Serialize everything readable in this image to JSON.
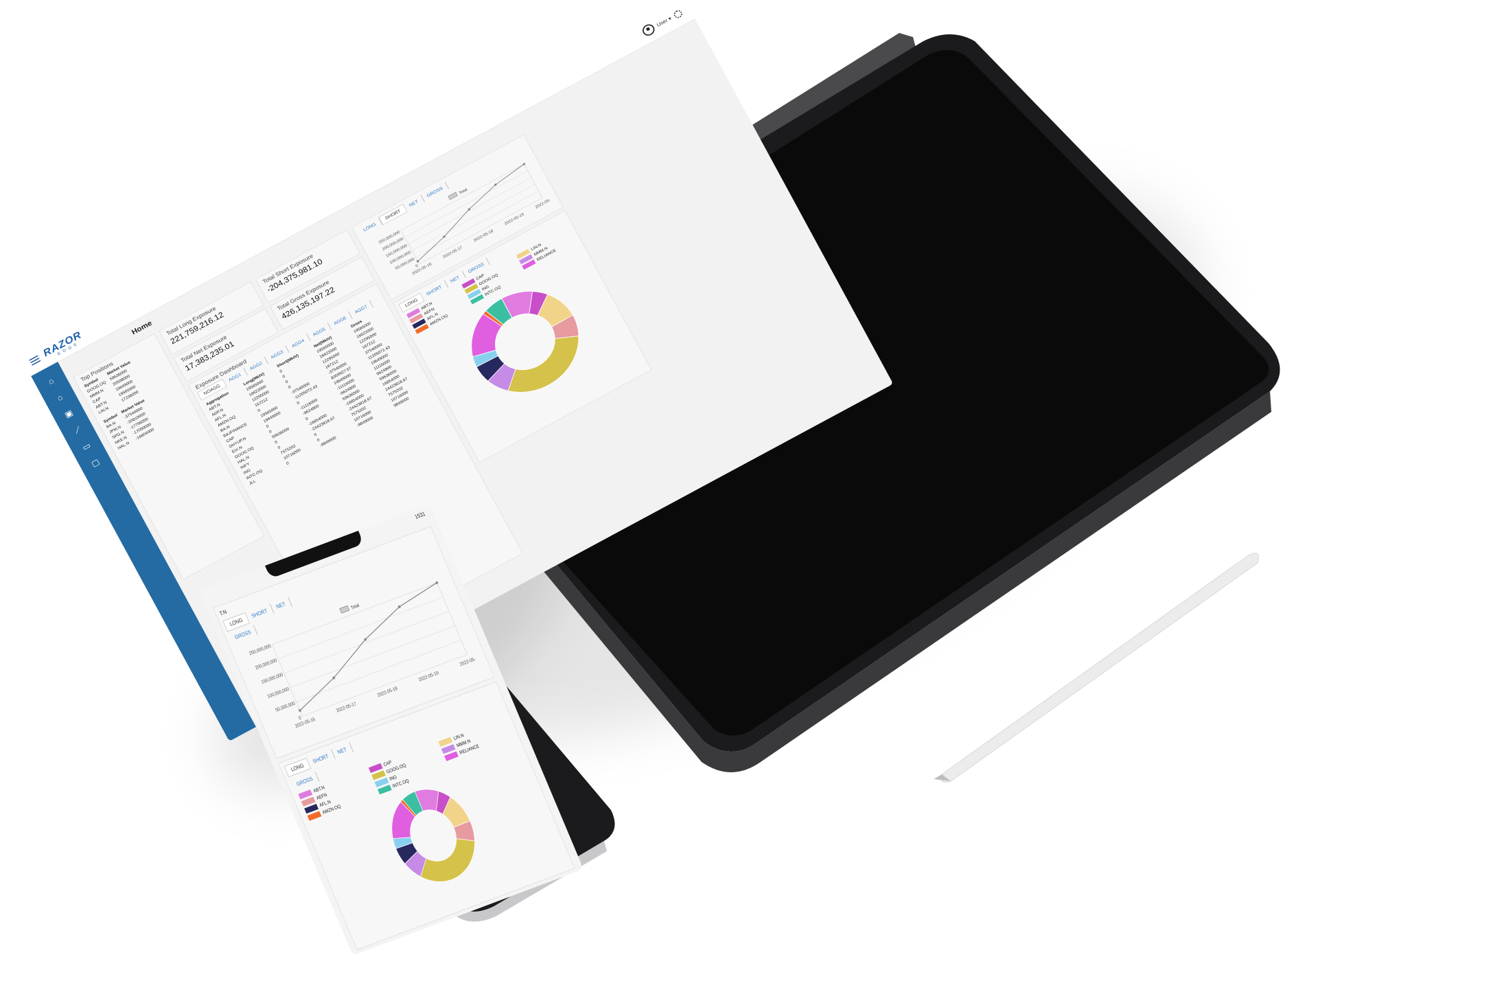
{
  "app": {
    "logo_main": "RAZOR",
    "logo_sub": "EDGE",
    "user_label": "User ▾"
  },
  "tablet": {
    "page_title": "Home",
    "top_positions": {
      "title": "Top Positions",
      "long_headers": [
        "Symbol",
        "Market Value"
      ],
      "long_rows": [
        [
          "GOOG.OQ",
          "59636000"
        ],
        [
          "MMM.N",
          "20598000"
        ],
        [
          "CAP",
          "19649000"
        ],
        [
          "ABT.N",
          "19565000"
        ],
        [
          "LIN.N",
          "17236000"
        ]
      ],
      "short_headers": [
        "Symbol",
        "Market Value"
      ],
      "short_rows": [
        [
          "BA.N",
          "-37540000"
        ],
        [
          "JPM.N",
          "-20810000"
        ],
        [
          "SPG.N",
          "-17796000"
        ],
        [
          "NKE.N",
          "-17090000"
        ],
        [
          "HAL.N",
          "-16604000"
        ]
      ]
    },
    "exposure": {
      "long_title": "Total Long Exposure",
      "long_value": "221,759,216.12",
      "short_title": "Total Short Exposure",
      "short_value": "-204,375,981.10",
      "net_title": "Total Net Exposure",
      "net_value": "17,383,235.01",
      "gross_title": "Total Gross Exposure",
      "gross_value": "426,135,197.22"
    },
    "dashboard": {
      "title": "Exposure Dashboard",
      "tabs": [
        "NOAGG",
        "AGG1",
        "AGG2",
        "AGG3",
        "AGG4",
        "AGG5",
        "AGG6",
        "AGG7"
      ],
      "headers": [
        "Aggregation",
        "Long(MktV)",
        "Short(MktV)",
        "Net(MktV)",
        "Gross"
      ],
      "rows": [
        [
          "ABT.N",
          "19565000",
          "0",
          "19565000",
          "19565000"
        ],
        [
          "ADF.N",
          "16622000",
          "0",
          "16622000",
          "16622000"
        ],
        [
          "AFL.N",
          "12295000",
          "0",
          "12295000",
          "12295000"
        ],
        [
          "AMZN.OQ",
          "167212",
          "0",
          "167212",
          "167212"
        ],
        [
          "BA.N",
          "0",
          "-37540000",
          "-37540000",
          "37540000"
        ],
        [
          "BAJFINANCE",
          "19565000",
          "-11205072.43",
          "8359927.57",
          "11205072.43"
        ],
        [
          "CAP",
          "19649000",
          "0",
          "19649000",
          "19649000"
        ],
        [
          "DHYUP.N",
          "0",
          "-11116000",
          "-11116000",
          "11116000"
        ],
        [
          "EIX.N",
          "0",
          "-9624800",
          "-9624800",
          "9624800"
        ],
        [
          "GOOG.OQ",
          "59636000",
          "0",
          "59636000",
          "59636000"
        ],
        [
          "HAL.N",
          "0",
          "-16854000",
          "-16854000",
          "16854000"
        ],
        [
          "INFY",
          "0",
          "-24423818.67",
          "-24423818.67",
          "24423818.67"
        ],
        [
          "ING",
          "7575202",
          "0",
          "7575202",
          "7575202"
        ],
        [
          "INTC.OQ",
          "10716000",
          "0",
          "10716000",
          "10716000"
        ],
        [
          "JLL",
          "0",
          "-9849000",
          "-9849000",
          "9849000"
        ]
      ]
    }
  },
  "line_chart": {
    "tabs": [
      "LONG",
      "SHORT",
      "NET",
      "GROSS"
    ],
    "legend": "Total",
    "chart_data": {
      "type": "line",
      "x": [
        "2022-05-16",
        "2022-05-17",
        "2022-05-18",
        "2022-05-19",
        "2022-05-20"
      ],
      "series": [
        {
          "name": "Total",
          "values": [
            20000000,
            80000000,
            160000000,
            220000000,
            260000000
          ]
        }
      ],
      "ylim": [
        50000000,
        250000000
      ],
      "yticks": [
        "250,000,000",
        "200,000,000",
        "150,000,000",
        "100,000,000",
        "50,000,000",
        "0"
      ]
    }
  },
  "pie_chart": {
    "tabs": [
      "LONG",
      "SHORT",
      "NET",
      "GROSS"
    ],
    "chart_data": {
      "type": "pie",
      "labels": [
        "ABT.N",
        "CAP",
        "LIN.N",
        "AEFN",
        "GOOG.OQ",
        "MMM.N",
        "AFL.N",
        "ING",
        "RELIANCE",
        "AMZN.OQ",
        "INTC.OQ"
      ],
      "values": [
        8,
        4,
        9,
        6,
        26,
        6,
        5,
        3,
        12,
        1,
        5
      ],
      "colors": [
        "#e07be0",
        "#c84fc8",
        "#f1d38a",
        "#e79aa0",
        "#d4c24a",
        "#c68be6",
        "#27285e",
        "#88d0ef",
        "#e05ee0",
        "#f26b2b",
        "#3bbfa0"
      ]
    }
  },
  "phone": {
    "status": "1531",
    "tab_label": "T.N"
  }
}
